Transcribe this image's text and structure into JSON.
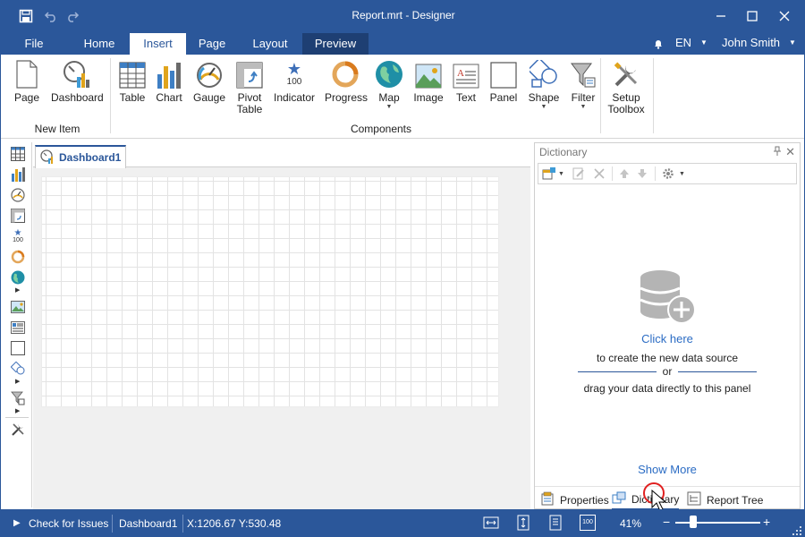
{
  "app": {
    "title": "Report.mrt - Designer"
  },
  "tabs": [
    {
      "label": "File"
    },
    {
      "label": "Home"
    },
    {
      "label": "Insert"
    },
    {
      "label": "Page"
    },
    {
      "label": "Layout"
    },
    {
      "label": "Preview"
    }
  ],
  "active_tab": "Insert",
  "header_right": {
    "language": "EN",
    "user": "John Smith"
  },
  "ribbon": {
    "groups": [
      {
        "label": "New Item",
        "items": [
          {
            "label": "Page"
          },
          {
            "label": "Dashboard"
          }
        ]
      },
      {
        "label": "Components",
        "items": [
          {
            "label": "Table"
          },
          {
            "label": "Chart"
          },
          {
            "label": "Gauge"
          },
          {
            "label": "Pivot Table"
          },
          {
            "label": "Indicator"
          },
          {
            "label": "Progress"
          },
          {
            "label": "Map"
          },
          {
            "label": "Image"
          },
          {
            "label": "Text"
          },
          {
            "label": "Panel"
          },
          {
            "label": "Shape"
          },
          {
            "label": "Filter"
          }
        ]
      },
      {
        "label": "",
        "items": [
          {
            "label": "Setup Toolbox"
          }
        ]
      }
    ],
    "pivot_line1": "Pivot",
    "pivot_line2": "Table",
    "setup_line1": "Setup",
    "setup_line2": "Toolbox",
    "indicator_badge": "100"
  },
  "document_tab": {
    "label": "Dashboard1"
  },
  "dictionary": {
    "title": "Dictionary",
    "click_here": "Click here",
    "create_text": "to create the new data source",
    "or_text": "or",
    "drag_text": "drag your data directly to this panel",
    "show_more": "Show More",
    "panel_tabs": [
      {
        "label": "Properties"
      },
      {
        "label": "Dictionary"
      },
      {
        "label": "Report Tree"
      }
    ],
    "active_panel_tab": "Dictionary"
  },
  "status_bar": {
    "check_issues": "Check for Issues",
    "page_name": "Dashboard1",
    "coords": "X:1206.67 Y:530.48",
    "zoom": "41%",
    "zoom_fraction": 0.41,
    "page_size_badge": "100"
  },
  "colors": {
    "brand": "#2b579a",
    "link": "#2b6cc4",
    "cursor_highlight": "#e02020"
  }
}
